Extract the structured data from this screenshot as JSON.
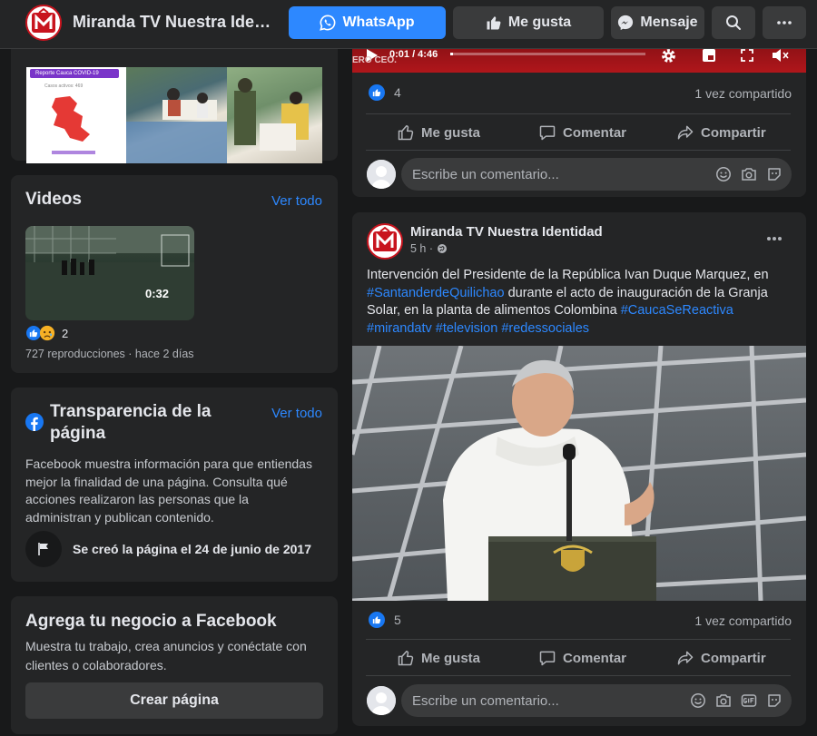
{
  "header": {
    "page_name": "Miranda TV Nuestra Identidad",
    "whatsapp_label": "WhatsApp",
    "like_label": "Me gusta",
    "message_label": "Mensaje"
  },
  "photos_card": {
    "infographic_title": "Reporte Cauca COVID-19",
    "infographic_sub": "Casos activos: 469"
  },
  "videos": {
    "title": "Videos",
    "see_all": "Ver todo",
    "duration": "0:32",
    "reaction_count": "2",
    "meta": "727 reproducciones · hace 2 días"
  },
  "transparency": {
    "title": "Transparencia de la página",
    "see_all": "Ver todo",
    "description": "Facebook muestra información para que entiendas mejor la finalidad de una página. Consulta qué acciones realizaron las personas que la administran y publican contenido.",
    "created": "Se creó la página el 24 de junio de 2017"
  },
  "business": {
    "title": "Agrega tu negocio a Facebook",
    "description": "Muestra tu trabajo, crea anuncios y conéctate con clientes o colaboradores.",
    "button": "Crear página"
  },
  "post1": {
    "video_time": "0:01 / 4:46",
    "overlay_text": "ERO CEO.",
    "likes": "4",
    "shares": "1 vez compartido",
    "like_action": "Me gusta",
    "comment_action": "Comentar",
    "share_action": "Compartir",
    "comment_placeholder": "Escribe un comentario..."
  },
  "post2": {
    "author": "Miranda TV Nuestra Identidad",
    "time": "5 h ·",
    "text_1": "Intervención del Presidente de la República Ivan Duque Marquez, en ",
    "hashtag_1": "#SantanderdeQuilichao",
    "text_2": " durante el acto  de inauguración de la Granja Solar, en la planta de alimentos Colombina  ",
    "hashtag_2": "#CaucaSeReactiva",
    "hashtag_3": "#mirandatv",
    "hashtag_4": "#television",
    "hashtag_5": "#redessociales",
    "likes": "5",
    "shares": "1 vez compartido",
    "like_action": "Me gusta",
    "comment_action": "Comentar",
    "share_action": "Compartir",
    "comment_placeholder": "Escribe un comentario..."
  },
  "colors": {
    "background": "#18191a",
    "card": "#242526",
    "accent": "#2d88ff",
    "brand_red": "#c8141e"
  }
}
